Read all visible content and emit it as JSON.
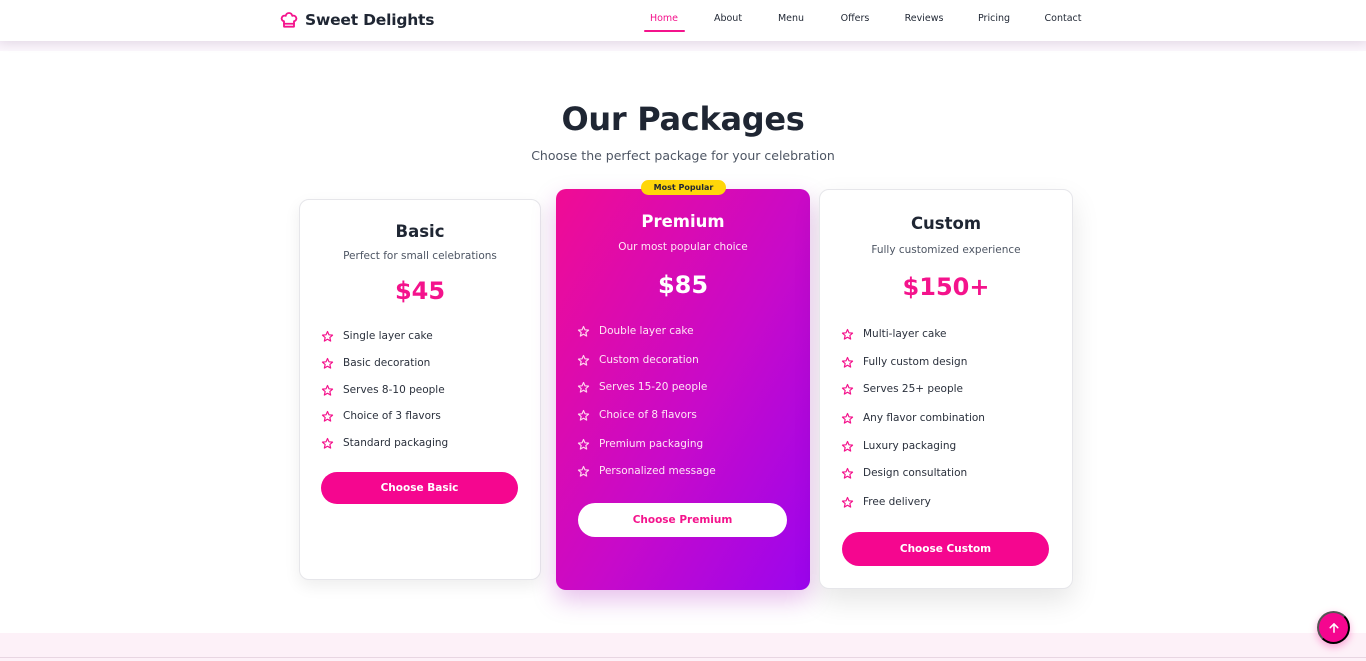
{
  "brand": {
    "name": "Sweet Delights",
    "icon": "chef-hat-icon",
    "color": "#f4138c"
  },
  "nav": {
    "items": [
      {
        "label": "Home",
        "active": true
      },
      {
        "label": "About"
      },
      {
        "label": "Menu"
      },
      {
        "label": "Offers"
      },
      {
        "label": "Reviews"
      },
      {
        "label": "Pricing"
      },
      {
        "label": "Contact"
      }
    ]
  },
  "section": {
    "title": "Our Packages",
    "subtitle": "Choose the perfect package for your celebration"
  },
  "packages": [
    {
      "name": "Basic",
      "description": "Perfect for small celebrations",
      "price": "$45",
      "features": [
        "Single layer cake",
        "Basic decoration",
        "Serves 8-10 people",
        "Choice of 3 flavors",
        "Standard packaging"
      ],
      "button": "Choose Basic"
    },
    {
      "name": "Premium",
      "badge": "Most Popular",
      "description": "Our most popular choice",
      "price": "$85",
      "features": [
        "Double layer cake",
        "Custom decoration",
        "Serves 15-20 people",
        "Choice of 8 flavors",
        "Premium packaging",
        "Personalized message"
      ],
      "button": "Choose Premium"
    },
    {
      "name": "Custom",
      "description": "Fully customized experience",
      "price": "$150+",
      "features": [
        "Multi-layer cake",
        "Fully custom design",
        "Serves 25+ people",
        "Any flavor combination",
        "Luxury packaging",
        "Design consultation",
        "Free delivery"
      ],
      "button": "Choose Custom"
    }
  ],
  "colors": {
    "accent": "#f4138c",
    "badge": "#ffd60a",
    "premium_gradient_start": "#f00c94",
    "premium_gradient_end": "#9b05ee"
  },
  "icons": {
    "feature": "star-outline-icon",
    "back_to_top": "arrow-up-icon"
  }
}
